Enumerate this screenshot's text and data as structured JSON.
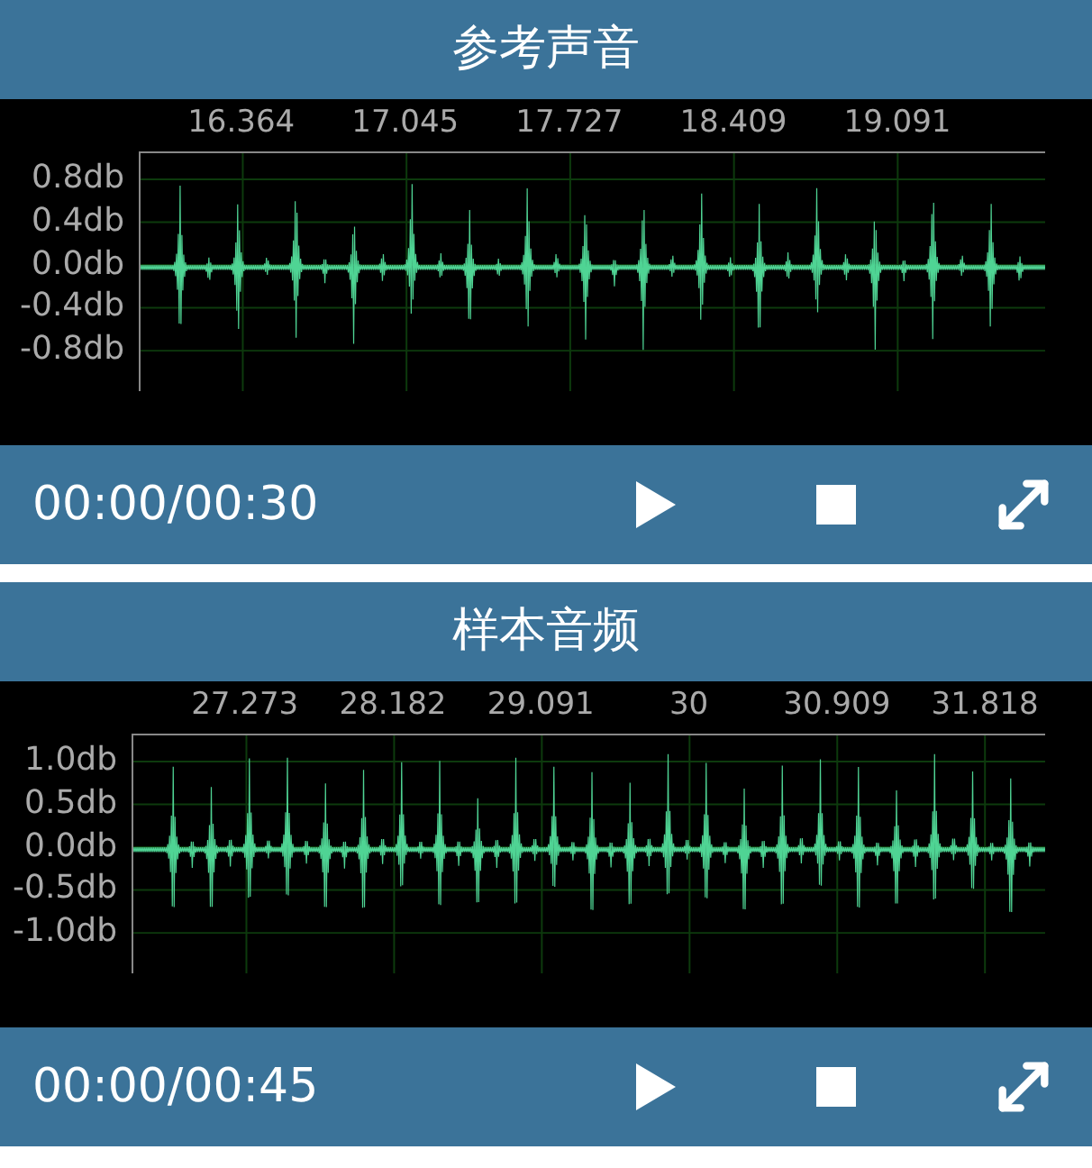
{
  "panels": [
    {
      "title": "参考声音",
      "x_ticks": [
        "16.364",
        "17.045",
        "17.727",
        "18.409",
        "19.091"
      ],
      "y_ticks": [
        "0.8db",
        "0.4db",
        "0.0db",
        "-0.4db",
        "-0.8db"
      ],
      "time": "00:00/00:30"
    },
    {
      "title": "样本音频",
      "x_ticks": [
        "27.273",
        "28.182",
        "29.091",
        "30",
        "30.909",
        "31.818"
      ],
      "y_ticks": [
        "1.0db",
        "0.5db",
        "0.0db",
        "-0.5db",
        "-1.0db"
      ],
      "time": "00:00/00:45"
    }
  ]
}
